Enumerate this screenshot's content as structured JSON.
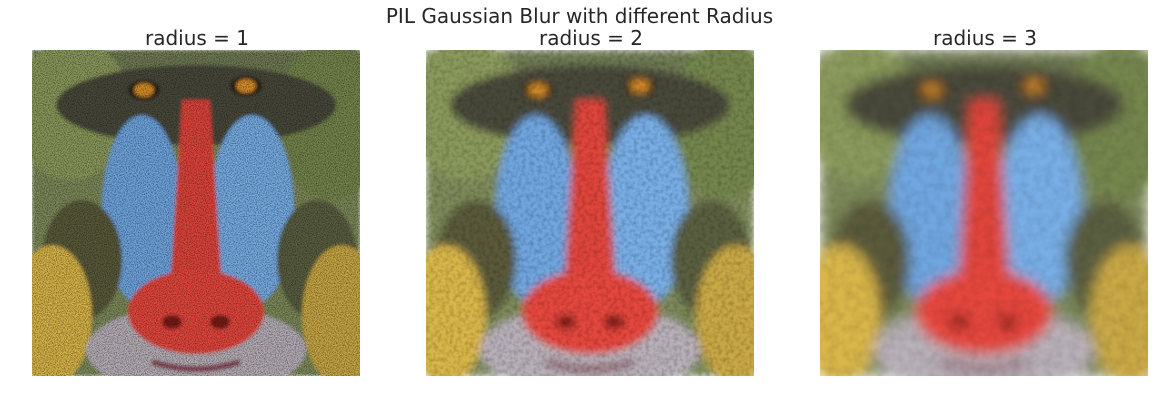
{
  "figure": {
    "title": "PIL Gaussian Blur with different Radius"
  },
  "panels": [
    {
      "title": "radius = 1",
      "blur": 1,
      "noise_visible": true
    },
    {
      "title": "radius = 2",
      "blur": 2,
      "noise_visible": false
    },
    {
      "title": "radius = 3",
      "blur": 3,
      "noise_visible": false
    }
  ],
  "colors": {
    "fur_green": "#7d8a5a",
    "fur_dark": "#3a3a2e",
    "cheek_blue": "#6fa6e0",
    "nose_red": "#e0443a",
    "eye_orange": "#d9902a",
    "beard_yellow": "#d9b64a",
    "chin_grey": "#b8b0b8"
  }
}
